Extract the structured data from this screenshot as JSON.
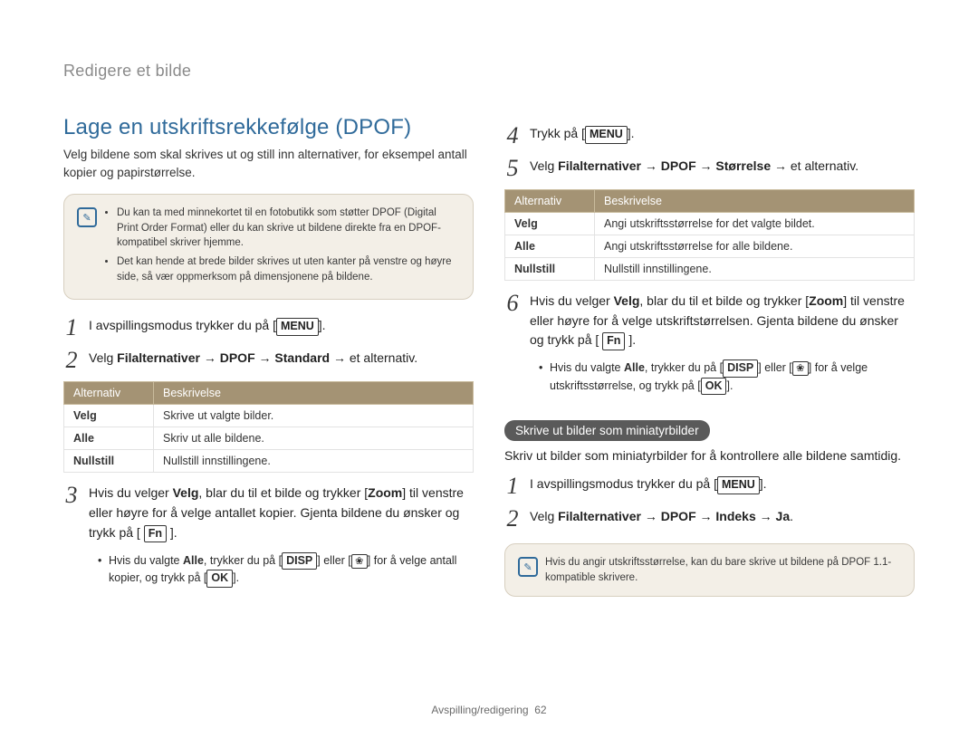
{
  "header": {
    "title": "Redigere et bilde"
  },
  "section": {
    "title": "Lage en utskriftsrekkefølge (DPOF)",
    "intro": "Velg bildene som skal skrives ut og still inn alternativer, for eksempel antall kopier og papirstørrelse."
  },
  "info1": {
    "b1": "Du kan ta med minnekortet til en fotobutikk som støtter DPOF (Digital Print Order Format) eller du kan skrive ut bildene direkte fra en DPOF-kompatibel skriver hjemme.",
    "b2": "Det kan hende at brede bilder skrives ut uten kanter på venstre og høyre side, så vær oppmerksom på dimensjonene på bildene."
  },
  "left_steps": {
    "s1": {
      "pre": "I avspillingsmodus trykker du på [",
      "key": "MENU",
      "post": "]."
    },
    "s2": {
      "pre": "Velg ",
      "bold": "Filalternativer → DPOF → Standard",
      "post": " → et alternativ."
    },
    "s3": {
      "p1": "Hvis du velger ",
      "b1": "Velg",
      "p2": ", blar du til et bilde og trykker [",
      "b2": "Zoom",
      "p3": "] til venstre eller høyre for å velge antallet kopier. Gjenta bildene du ønsker og trykk på [ ",
      "key": "Fn",
      "p4": " ]."
    },
    "s3_bullet": {
      "t1": "Hvis du valgte ",
      "b1": "Alle",
      "t2": ", trykker du på [",
      "b2": "DISP",
      "t3": "] eller [",
      "t4": "] for å velge antall kopier, og trykk på [",
      "b3": "OK",
      "t5": "]."
    }
  },
  "table1": {
    "h1": "Alternativ",
    "h2": "Beskrivelse",
    "r1k": "Velg",
    "r1v": "Skrive ut valgte bilder.",
    "r2k": "Alle",
    "r2v": "Skriv ut alle bildene.",
    "r3k": "Nullstill",
    "r3v": "Nullstill innstillingene."
  },
  "right_steps": {
    "s4": {
      "pre": "Trykk på [",
      "key": "MENU",
      "post": "]."
    },
    "s5": {
      "pre": "Velg ",
      "bold": "Filalternativer → DPOF → Størrelse",
      "post": " → et alternativ."
    },
    "s6": {
      "p1": "Hvis du velger ",
      "b1": "Velg",
      "p2": ", blar du til et bilde og trykker [",
      "b2": "Zoom",
      "p3": "] til venstre eller høyre for å velge utskriftstørrelsen. Gjenta bildene du ønsker og trykk på [ ",
      "key": "Fn",
      "p4": " ]."
    },
    "s6_bullet": {
      "t1": "Hvis du valgte ",
      "b1": "Alle",
      "t2": ", trykker du på [",
      "b2": "DISP",
      "t3": "] eller [",
      "t4": "] for å velge utskriftsstørrelse, og trykk på [",
      "b3": "OK",
      "t5": "]."
    }
  },
  "table2": {
    "h1": "Alternativ",
    "h2": "Beskrivelse",
    "r1k": "Velg",
    "r1v": "Angi utskriftsstørrelse for det valgte bildet.",
    "r2k": "Alle",
    "r2v": "Angi utskriftsstørrelse for alle bildene.",
    "r3k": "Nullstill",
    "r3v": "Nullstill innstillingene."
  },
  "thumb": {
    "label": "Skrive ut bilder som miniatyrbilder",
    "body": "Skriv ut bilder som miniatyrbilder for å kontrollere alle bildene samtidig.",
    "s1": {
      "pre": "I avspillingsmodus trykker du på [",
      "key": "MENU",
      "post": "]."
    },
    "s2": {
      "pre": "Velg ",
      "bold": "Filalternativer → DPOF → Indeks → Ja",
      "post": "."
    }
  },
  "info2": {
    "text": "Hvis du angir utskriftsstørrelse, kan du bare skrive ut bildene på DPOF 1.1-kompatible skrivere."
  },
  "footer": {
    "section": "Avspilling/redigering",
    "pagenum": "62"
  }
}
